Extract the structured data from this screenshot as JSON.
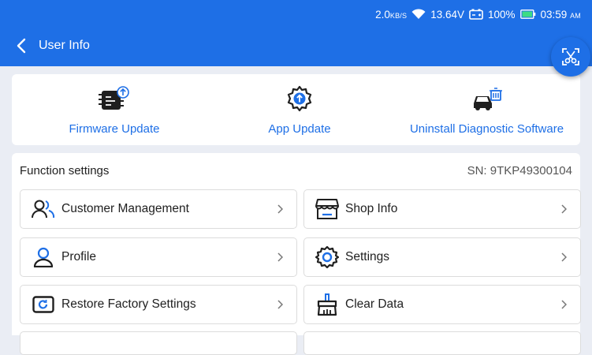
{
  "status_bar": {
    "net_speed": "2.0",
    "net_unit": "KB/S",
    "voltage": "13.64",
    "voltage_unit": "V",
    "battery": "100%",
    "time": "03:59",
    "ampm": "AM"
  },
  "header": {
    "title": "User Info"
  },
  "updates": [
    {
      "label": "Firmware Update",
      "icon": "firmware-update-icon"
    },
    {
      "label": "App Update",
      "icon": "app-update-icon"
    },
    {
      "label": "Uninstall Diagnostic Software",
      "icon": "uninstall-car-icon"
    }
  ],
  "function_settings": {
    "heading": "Function settings",
    "sn": "SN: 9TKP49300104",
    "items": [
      {
        "label": "Customer Management",
        "icon": "customers-icon"
      },
      {
        "label": "Shop Info",
        "icon": "shop-icon"
      },
      {
        "label": "Profile",
        "icon": "profile-icon"
      },
      {
        "label": "Settings",
        "icon": "settings-gear-icon"
      },
      {
        "label": "Restore Factory Settings",
        "icon": "restore-icon"
      },
      {
        "label": "Clear Data",
        "icon": "broom-icon"
      }
    ]
  },
  "colors": {
    "accent": "#1e6fe6",
    "background": "#eaedf4"
  }
}
